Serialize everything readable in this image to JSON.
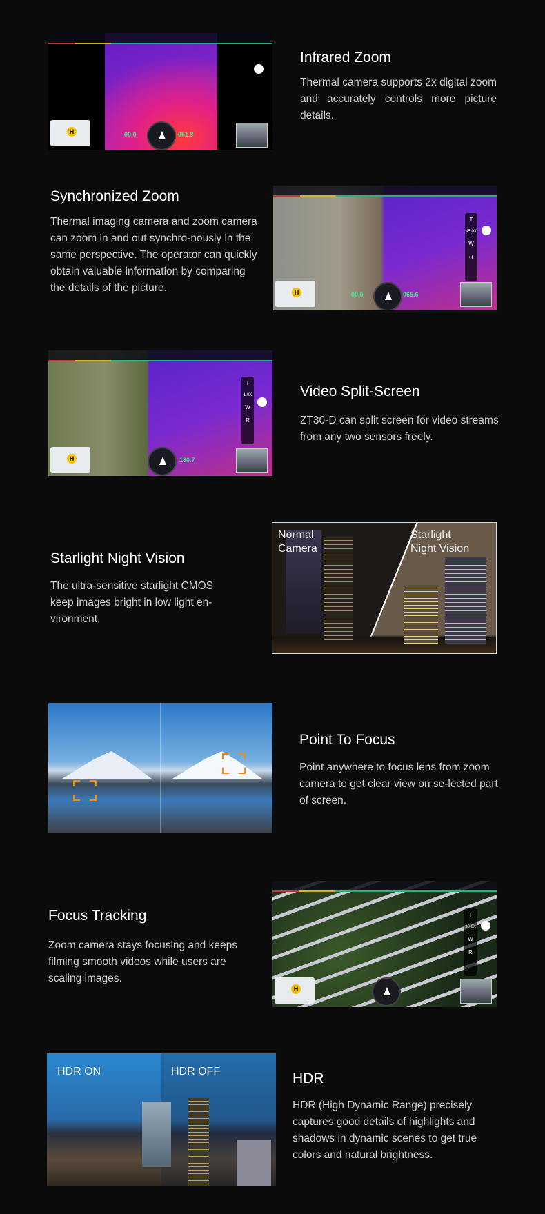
{
  "sections": [
    {
      "title": "Infrared Zoom",
      "body": "Thermal camera supports 2x digital zoom and accurately controls more picture details.",
      "readouts": {
        "speed": "00.0",
        "altitude": "051.8"
      }
    },
    {
      "title": "Synchronized Zoom",
      "body": "Thermal imaging camera and zoom camera can zoom in and out synchro-nously in the same perspective. The operator can quickly obtain valuable information by comparing the details of the picture.",
      "readouts": {
        "zoom": "45.0X",
        "speed": "00.0",
        "altitude": "065.6"
      }
    },
    {
      "title": "Video Split-Screen",
      "body": "ZT30-D can split screen for video streams from any two sensors freely.",
      "readouts": {
        "zoom": "1.0X",
        "altitude": "180.7"
      }
    },
    {
      "title": "Starlight Night Vision",
      "body": "The ultra-sensitive starlight CMOS keep images bright in low light en-vironment.",
      "labels": {
        "left": "Normal Camera",
        "right": "Starlight Night Vision"
      }
    },
    {
      "title": "Point To Focus",
      "body": "Point anywhere to focus lens from zoom camera to get clear view on se-lected part of screen."
    },
    {
      "title": "Focus Tracking",
      "body": "Zoom camera stays focusing and keeps filming smooth videos while users are scaling images.",
      "readouts": {
        "zoom": "30.0X"
      }
    },
    {
      "title": "HDR",
      "body": "HDR (High Dynamic Range) precisely captures good details of highlights and shadows in dynamic scenes to get true colors and natural brightness.",
      "labels": {
        "left": "HDR ON",
        "right": "HDR OFF"
      }
    }
  ],
  "zoom_controls": {
    "tele": "T",
    "wide": "W",
    "reset": "R"
  },
  "icons": [
    "home-point-icon",
    "compass-icon",
    "shutter-icon",
    "focus-bracket-icon"
  ],
  "colors": {
    "background": "#0b0b0b",
    "telemetry": "#3fe88f",
    "focus_bracket": "#ff8a00",
    "map_home": "#f5c400"
  }
}
